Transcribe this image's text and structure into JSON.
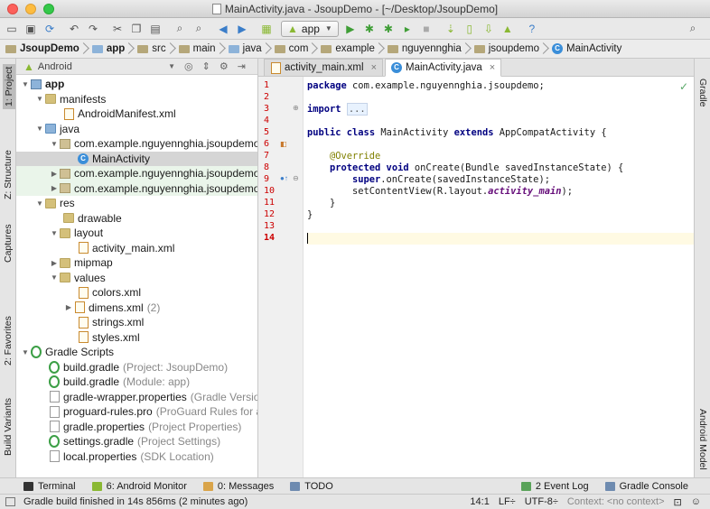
{
  "window": {
    "title": "MainActivity.java - JsoupDemo - [~/Desktop/JsoupDemo]"
  },
  "toolbar": {
    "run_config": "app"
  },
  "breadcrumbs": [
    "JsoupDemo",
    "app",
    "src",
    "main",
    "java",
    "com",
    "example",
    "nguyennghia",
    "jsoupdemo",
    "MainActivity"
  ],
  "left_strip": {
    "project": "1: Project",
    "structure": "Z: Structure",
    "captures": "Captures",
    "favorites": "2: Favorites",
    "build_variants": "Build Variants"
  },
  "right_strip": {
    "gradle": "Gradle",
    "android_model": "Android Model"
  },
  "project_panel": {
    "view_mode": "Android",
    "tree": {
      "app": "app",
      "manifests": "manifests",
      "android_manifest": "AndroidManifest.xml",
      "java": "java",
      "pkg_main": "com.example.nguyennghia.jsoupdemo",
      "main_activity": "MainActivity",
      "pkg_android_test": "com.example.nguyennghia.jsoupdemo",
      "pkg_test": "com.example.nguyennghia.jsoupdemo",
      "res": "res",
      "drawable": "drawable",
      "layout": "layout",
      "activity_main": "activity_main.xml",
      "mipmap": "mipmap",
      "values": "values",
      "colors": "colors.xml",
      "dimens": "dimens.xml",
      "dimens_count": "(2)",
      "strings": "strings.xml",
      "styles": "styles.xml",
      "gradle_scripts": "Gradle Scripts",
      "build_gradle_project": "build.gradle",
      "build_gradle_project_note": "(Project: JsoupDemo)",
      "build_gradle_module": "build.gradle",
      "build_gradle_module_note": "(Module: app)",
      "gradle_wrapper": "gradle-wrapper.properties",
      "gradle_wrapper_note": "(Gradle Version",
      "proguard": "proguard-rules.pro",
      "proguard_note": "(ProGuard Rules for ap",
      "gradle_properties": "gradle.properties",
      "gradle_properties_note": "(Project Properties)",
      "settings_gradle": "settings.gradle",
      "settings_gradle_note": "(Project Settings)",
      "local_properties": "local.properties",
      "local_properties_note": "(SDK Location)"
    }
  },
  "editor": {
    "tabs": [
      {
        "label": "activity_main.xml",
        "active": false
      },
      {
        "label": "MainActivity.java",
        "active": true
      }
    ],
    "line_numbers": [
      "1",
      "2",
      "3",
      "4",
      "5",
      "6",
      "7",
      "8",
      "9",
      "10",
      "11",
      "12",
      "13",
      "14"
    ],
    "code": {
      "l1_kw": "package",
      "l1_rest": " com.example.nguyennghia.jsoupdemo;",
      "l3_kw": "import",
      "l3_fold": "...",
      "l6_kw1": "public class",
      "l6_mid": " MainActivity ",
      "l6_kw2": "extends",
      "l6_rest": " AppCompatActivity {",
      "l8_ann": "@Override",
      "l9_kw": "protected void",
      "l9_rest": " onCreate(Bundle savedInstanceState) {",
      "l10_kw": "super",
      "l10_rest": ".onCreate(savedInstanceState);",
      "l11_a": "setContentView(R.layout.",
      "l11_it": "activity_main",
      "l11_b": ");",
      "l12": "}",
      "l13": "}"
    }
  },
  "bottom_tools": {
    "terminal": "Terminal",
    "android_monitor": "6: Android Monitor",
    "messages": "0: Messages",
    "todo": "TODO",
    "event_log": "2 Event Log",
    "gradle_console": "Gradle Console"
  },
  "status": {
    "message": "Gradle build finished in 14s 856ms (2 minutes ago)",
    "position": "14:1",
    "line_sep": "LF÷",
    "encoding": "UTF-8÷",
    "context": "Context: <no context>"
  },
  "colors": {
    "android_green": "#8ab833",
    "keyword": "#000080",
    "annotation": "#808000",
    "current_line": "#fffae3",
    "line_number_red": "#cc0000"
  }
}
